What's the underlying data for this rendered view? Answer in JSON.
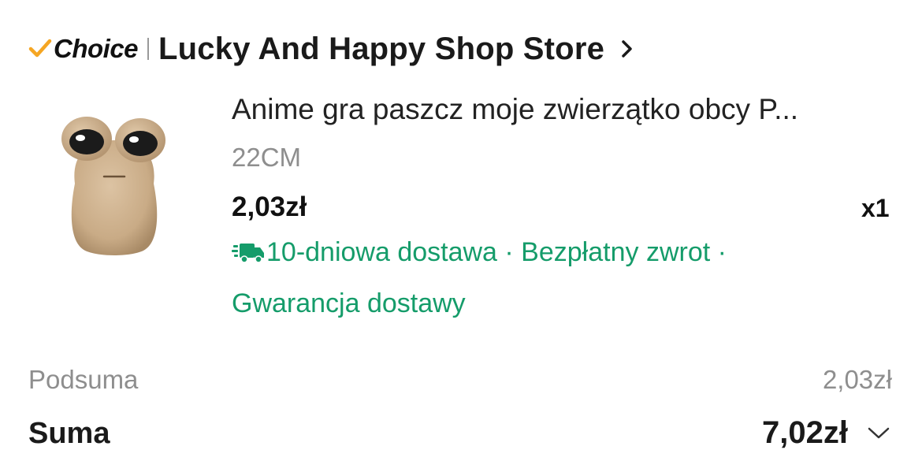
{
  "header": {
    "choice_label": "Choice",
    "store_name": "Lucky And Happy Shop Store",
    "icons": {
      "check": "checkmark-icon",
      "chevron": "chevron-right-icon"
    },
    "accent_color": "#f5a623"
  },
  "product": {
    "title": "Anime gra paszcz moje zwierzątko obcy P...",
    "variant": "22CM",
    "price": "2,03zł",
    "quantity": "x1",
    "delivery": {
      "text": "10-dniowa dostawa · Bezpłatny zwrot ·",
      "guarantee": "Gwarancja dostawy",
      "icon": "truck-icon",
      "color": "#159c6a"
    }
  },
  "summary": {
    "subtotal_label": "Podsuma",
    "subtotal_value": "2,03zł",
    "total_label": "Suma",
    "total_value": "7,02zł",
    "expand_icon": "chevron-down-icon"
  }
}
